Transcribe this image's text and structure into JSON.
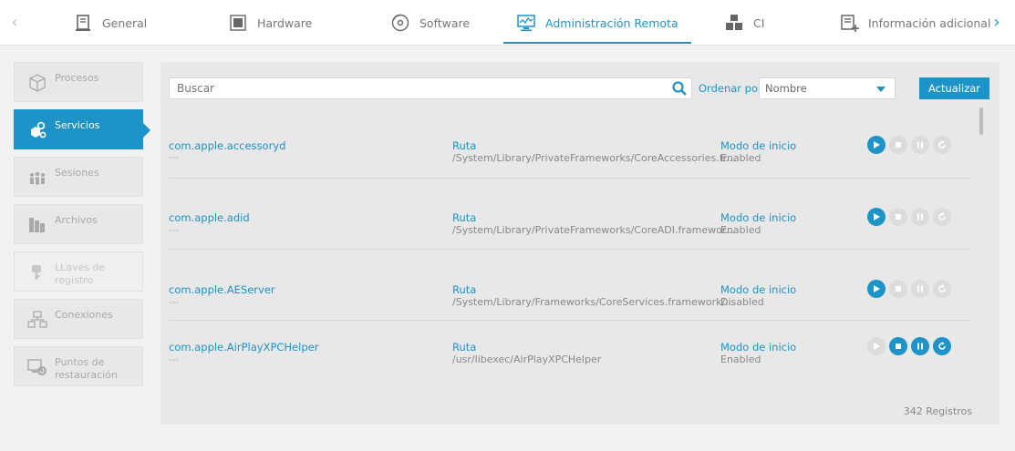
{
  "tabs": [
    {
      "label": "General",
      "icon": "document-icon"
    },
    {
      "label": "Hardware",
      "icon": "chip-icon"
    },
    {
      "label": "Software",
      "icon": "disc-icon"
    },
    {
      "label": "Administración Remota",
      "icon": "monitor-icon",
      "active": true
    },
    {
      "label": "CI",
      "icon": "boxes-icon"
    },
    {
      "label": "Información adicional",
      "icon": "add-doc-icon"
    }
  ],
  "sidebar": {
    "items": [
      {
        "label": "Procesos",
        "icon": "cube-icon"
      },
      {
        "label": "Servicios",
        "icon": "gears-icon",
        "active": true
      },
      {
        "label": "Sesiones",
        "icon": "users-icon"
      },
      {
        "label": "Archivos",
        "icon": "files-icon"
      },
      {
        "label": "LLaves de registro",
        "icon": "key-icon",
        "disabled": true
      },
      {
        "label": "Conexiones",
        "icon": "network-icon"
      },
      {
        "label": "Puntos de restauración",
        "icon": "restore-icon"
      }
    ]
  },
  "toolbar": {
    "search_placeholder": "Buscar",
    "sort_label": "Ordenar por:",
    "sort_value": "Nombre",
    "refresh_label": "Actualizar"
  },
  "services": [
    {
      "name": "com.apple.accessoryd",
      "sub": "---",
      "path_label": "Ruta",
      "path": "/System/Library/PrivateFrameworks/CoreAccessories.fr...",
      "mode_label": "Modo de inicio",
      "mode": "Enabled",
      "running": false
    },
    {
      "name": "com.apple.adid",
      "sub": "---",
      "path_label": "Ruta",
      "path": "/System/Library/PrivateFrameworks/CoreADI.framewor...",
      "mode_label": "Modo de inicio",
      "mode": "Enabled",
      "running": false
    },
    {
      "name": "com.apple.AEServer",
      "sub": "---",
      "path_label": "Ruta",
      "path": "/System/Library/Frameworks/CoreServices.framework/...",
      "mode_label": "Modo de inicio",
      "mode": "Disabled",
      "running": false
    },
    {
      "name": "com.apple.AirPlayXPCHelper",
      "sub": "---",
      "path_label": "Ruta",
      "path": "/usr/libexec/AirPlayXPCHelper",
      "mode_label": "Modo de inicio",
      "mode": "Enabled",
      "running": true
    }
  ],
  "footer": {
    "total": "342 Registros"
  },
  "colors": {
    "accent": "#1e93c8",
    "panel": "#e8e8e8",
    "disabled": "#dcdcdc"
  }
}
